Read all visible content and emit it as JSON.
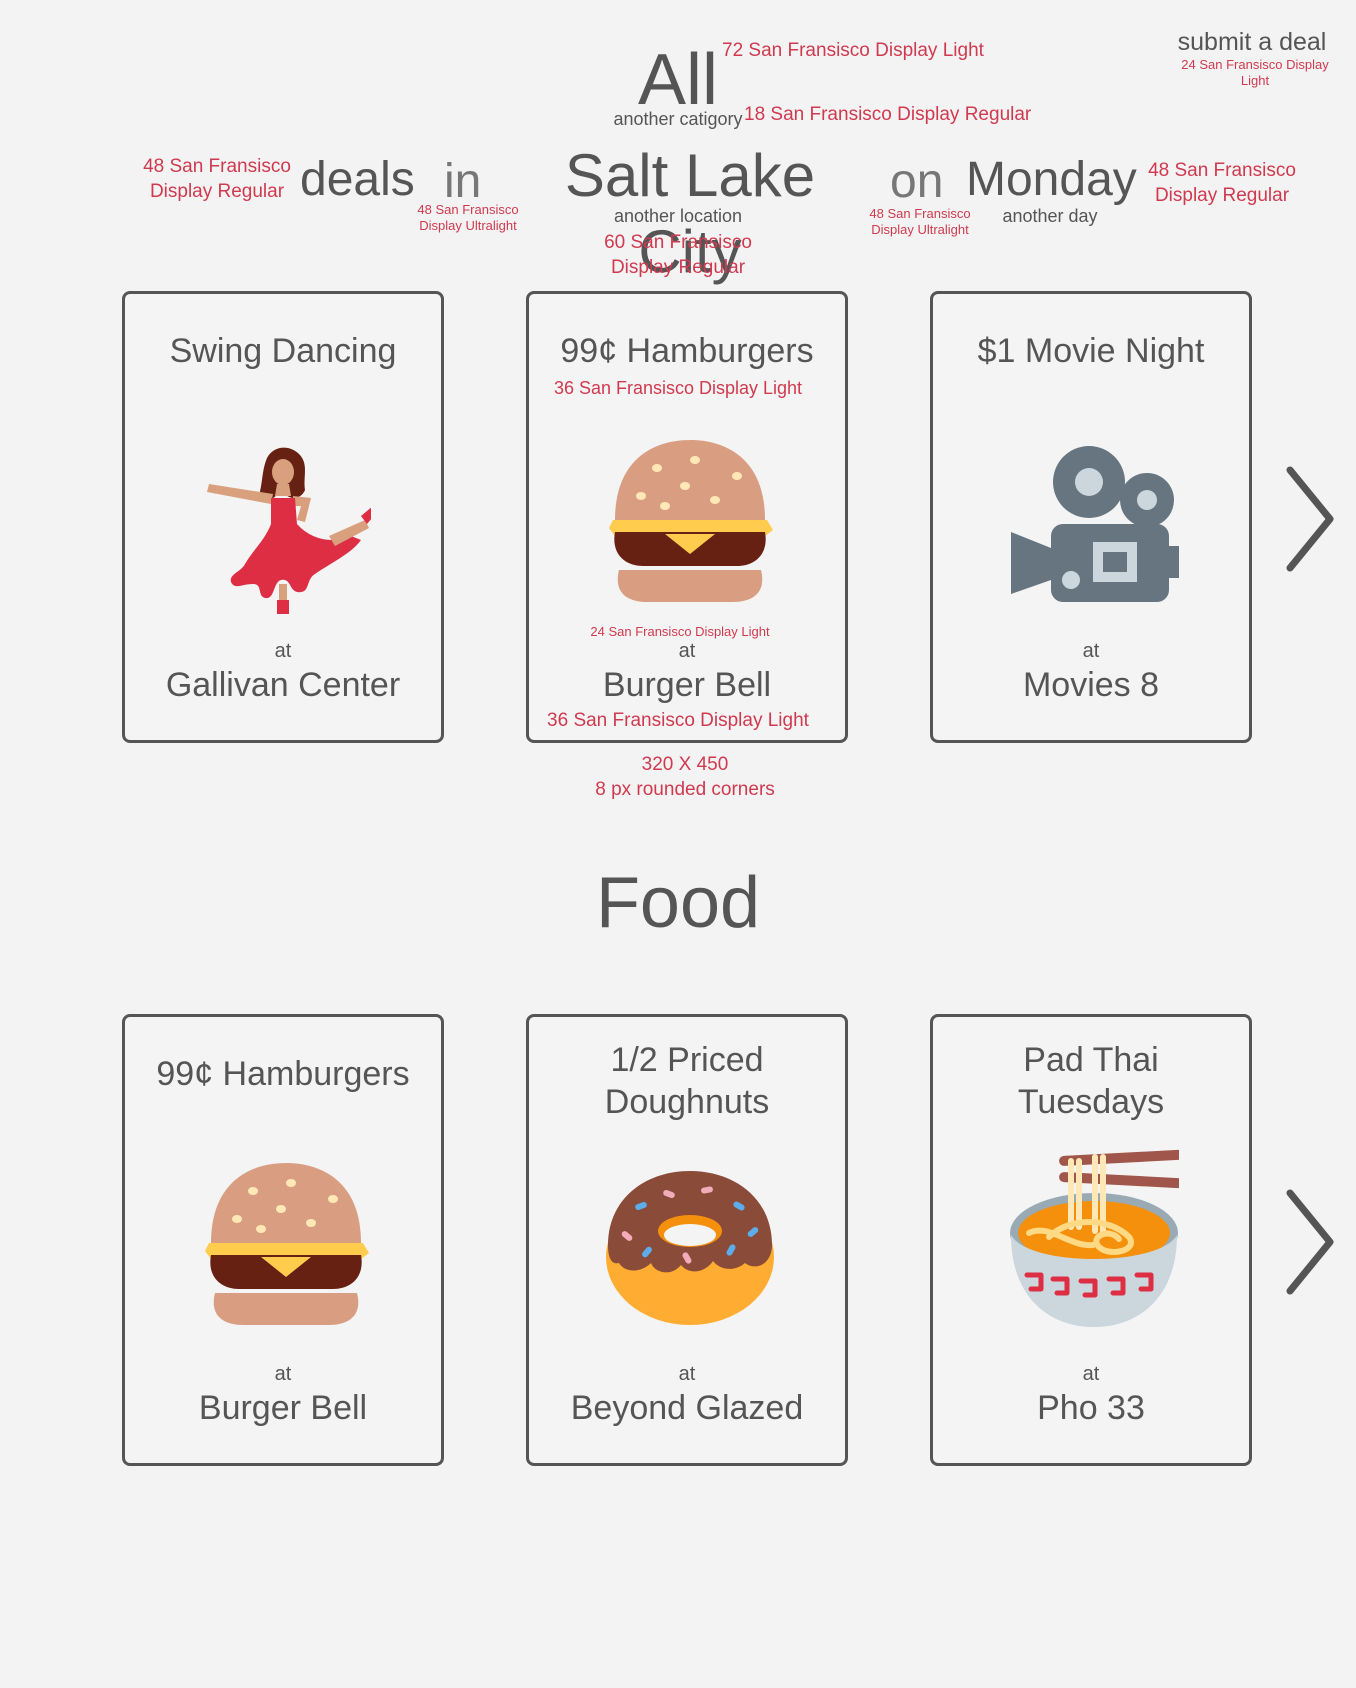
{
  "header": {
    "submit_link": "submit a deal",
    "submit_note": "24 San Fransisco Display Light",
    "category": "All",
    "category_hint": "another catigory",
    "category_note_size": "72 San Fransisco Display Light",
    "category_hint_note": "18 San Fransisco Display Regular",
    "deals_note": "48 San Fransisco Display Regular",
    "deals_word": "deals",
    "in_word": "in",
    "in_note": "48 San Fransisco Display Ultralight",
    "city": "Salt Lake City",
    "city_hint": "another location",
    "city_note": "60 San Fransisco Display Regular",
    "on_word": "on",
    "on_note": "48 San Fransisco Display Ultralight",
    "day": "Monday",
    "day_hint": "another day",
    "day_note": "48 San Fransisco Display Regular"
  },
  "featured": {
    "cards": [
      {
        "title": "Swing Dancing",
        "at": "at",
        "venue": "Gallivan Center",
        "icon": "dancer-icon"
      },
      {
        "title": "99¢ Hamburgers",
        "at": "at",
        "venue": "Burger Bell",
        "icon": "hamburger-icon"
      },
      {
        "title": "$1 Movie Night",
        "at": "at",
        "venue": "Movies 8",
        "icon": "movie-camera-icon"
      }
    ],
    "title_note": "36 San Fransisco Display Light",
    "at_note": "24 San Fransisco Display Light",
    "venue_note": "36 San Fransisco Display Light",
    "dim_note_size": "320 X 450",
    "dim_note_corners": "8 px rounded corners"
  },
  "food": {
    "section_title": "Food",
    "cards": [
      {
        "title": "99¢ Hamburgers",
        "at": "at",
        "venue": "Burger Bell",
        "icon": "hamburger-icon"
      },
      {
        "title": "1/2 Priced Doughnuts",
        "at": "at",
        "venue": "Beyond Glazed",
        "icon": "doughnut-icon"
      },
      {
        "title": "Pad Thai Tuesdays",
        "at": "at",
        "venue": "Pho 33",
        "icon": "noodle-bowl-icon"
      }
    ]
  },
  "colors": {
    "text": "#555555",
    "annotation": "#d03a4f",
    "background": "#f3f3f3",
    "card_border": "#555555"
  }
}
